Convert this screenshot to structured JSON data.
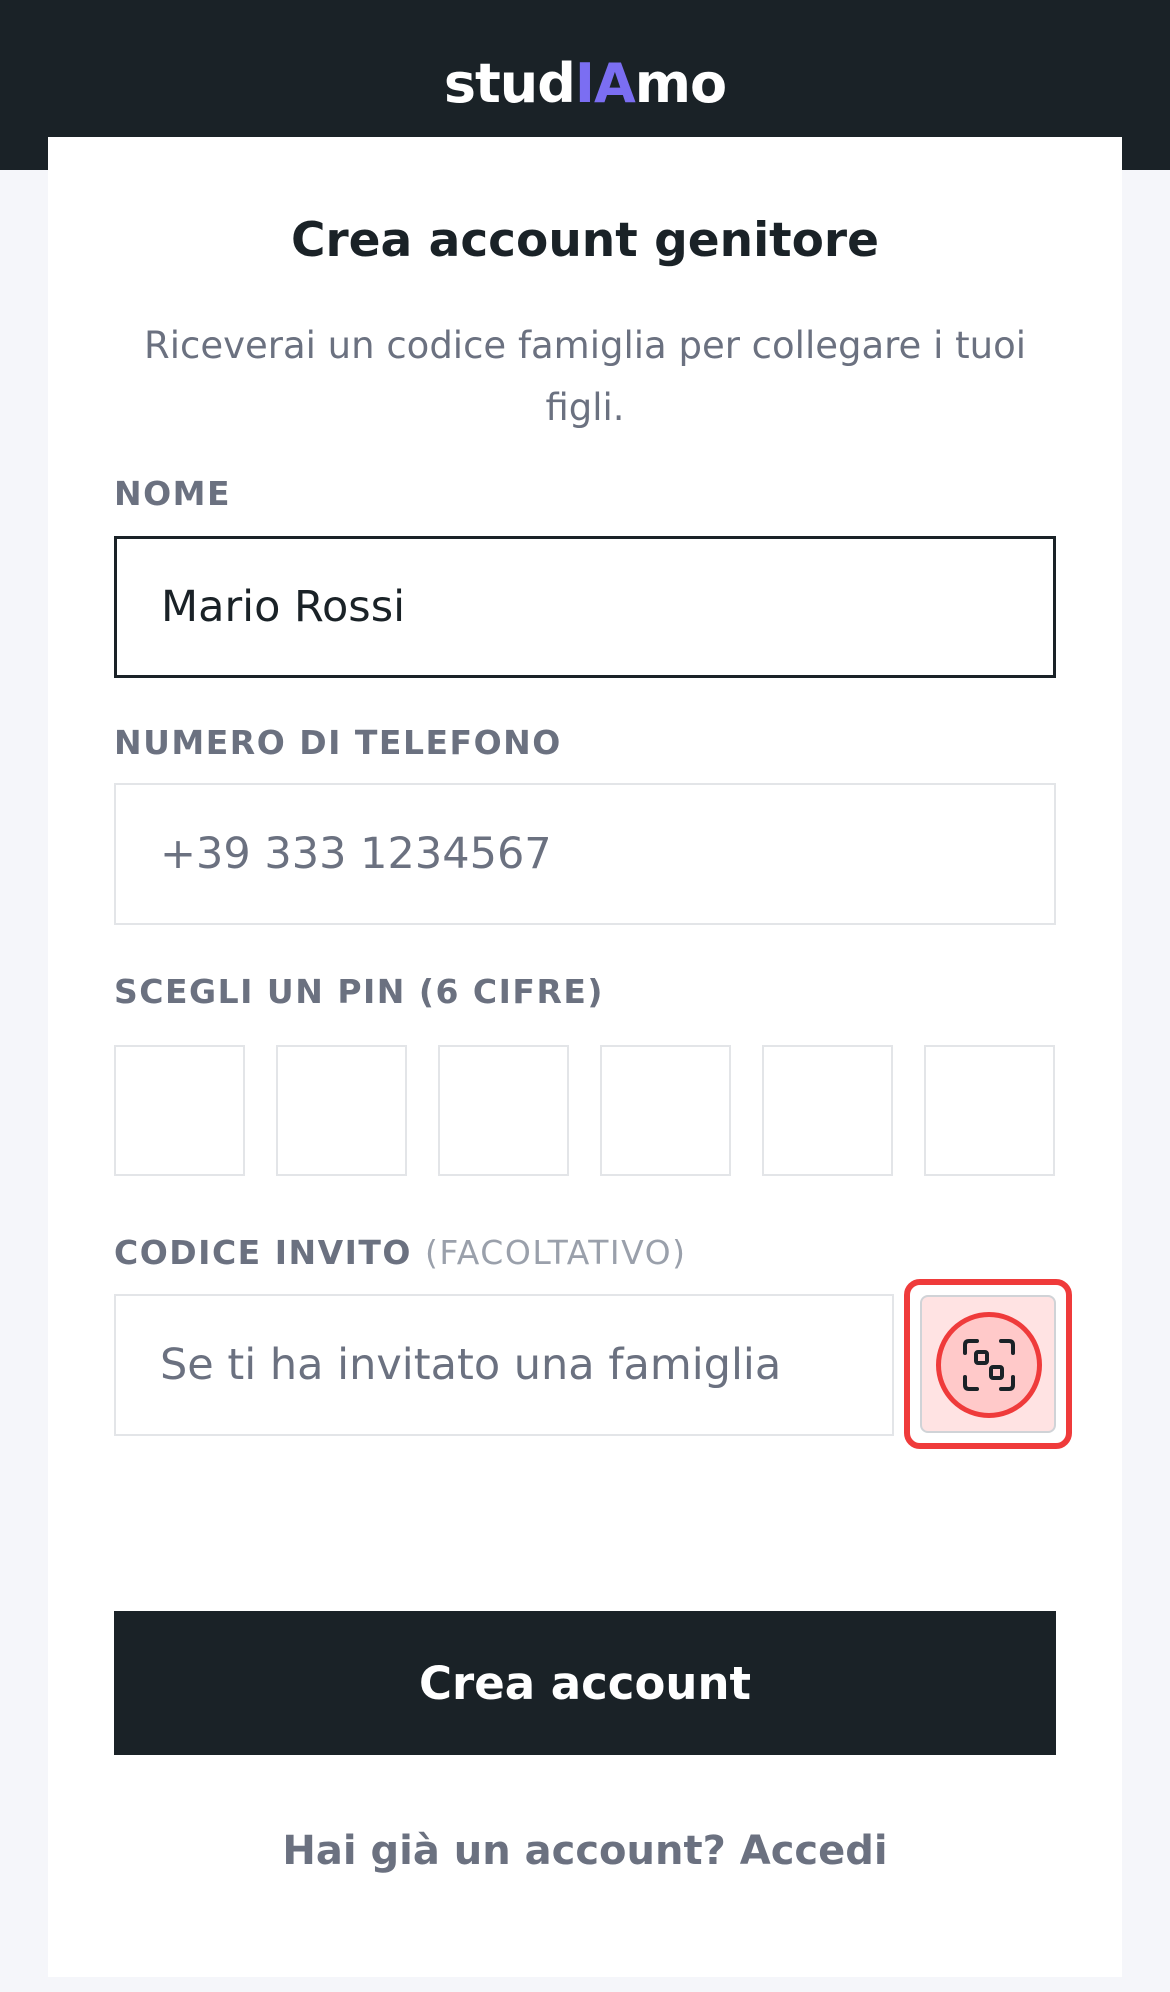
{
  "header": {
    "logo_prefix": "stud",
    "logo_accent": "IA",
    "logo_suffix": "mo",
    "accent_color": "#7b6ef2"
  },
  "form": {
    "title": "Crea account genitore",
    "subtitle": "Riceverai un codice famiglia per collegare i tuoi figli.",
    "name": {
      "label": "NOME",
      "value": "Mario Rossi"
    },
    "phone": {
      "label": "NUMERO DI TELEFONO",
      "placeholder": "+39 333 1234567"
    },
    "pin": {
      "label": "SCEGLI UN PIN (6 CIFRE)",
      "digits": [
        "",
        "",
        "",
        "",
        "",
        ""
      ]
    },
    "invite": {
      "label": "CODICE INVITO",
      "label_optional": "(FACOLTATIVO)",
      "placeholder": "Se ti ha invitato una famiglia",
      "scan_icon": "qr-scan-icon"
    },
    "submit_label": "Crea account",
    "login_prompt": "Hai già un account? Accedi"
  }
}
